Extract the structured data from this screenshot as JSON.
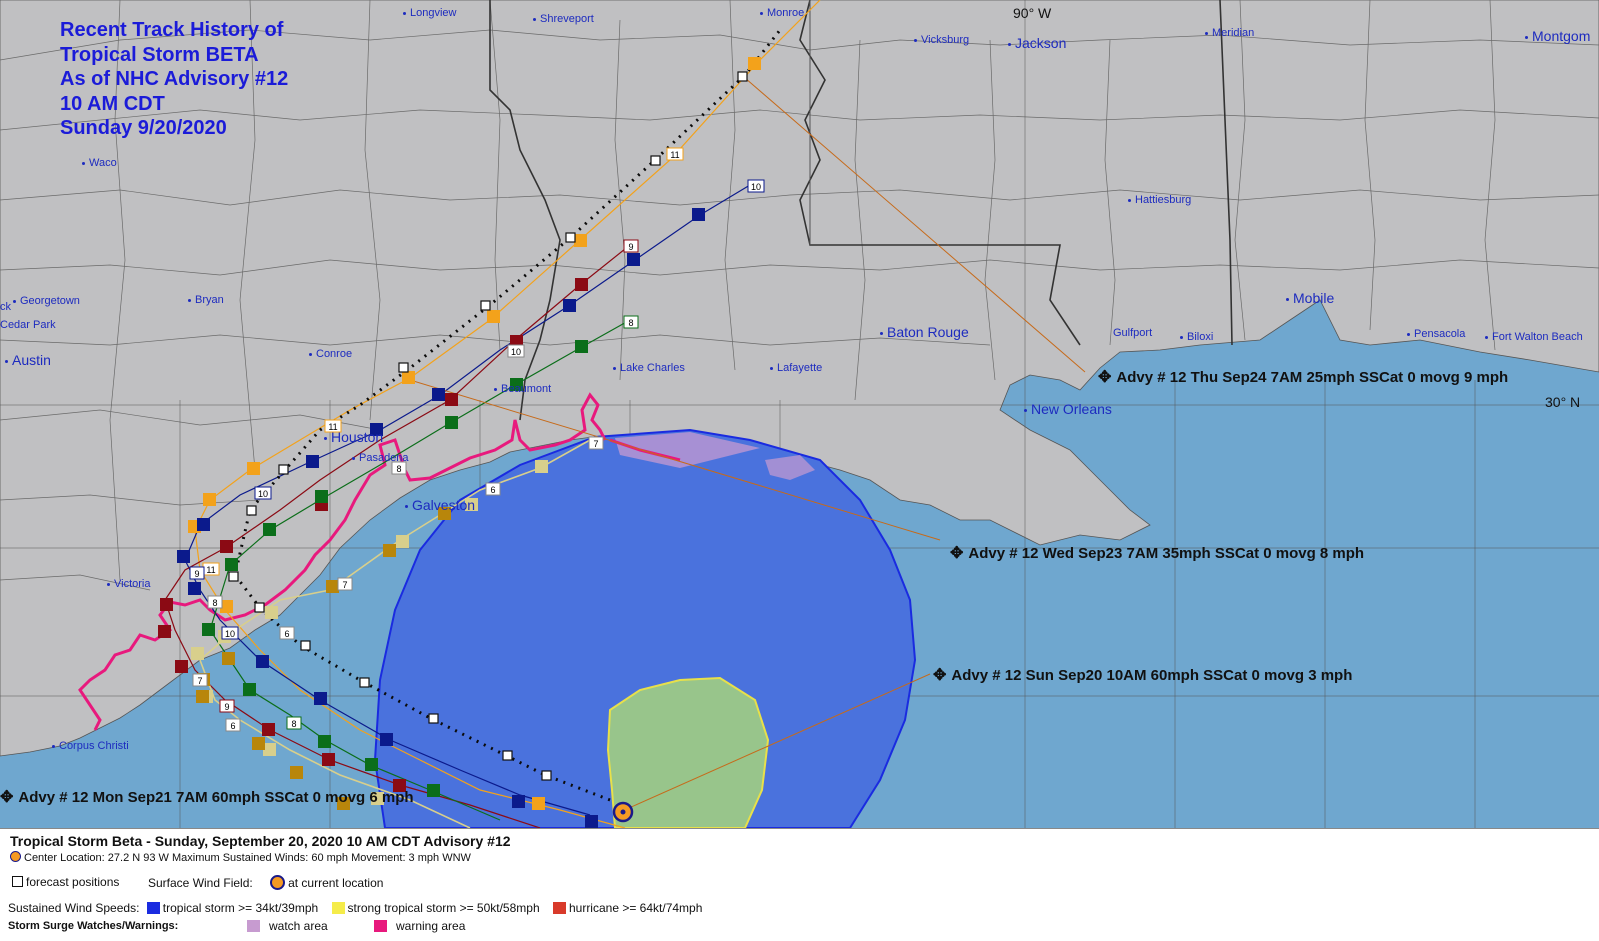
{
  "title_lines": [
    "Recent Track History of",
    "Tropical Storm BETA",
    "As of NHC Advisory #12",
    "10 AM CDT",
    "Sunday 9/20/2020"
  ],
  "cities": {
    "longview": "Longview",
    "shreveport": "Shreveport",
    "monroe": "Monroe",
    "vicksburg": "Vicksburg",
    "jackson": "Jackson",
    "meridian": "Meridian",
    "montgomery": "Montgom",
    "waco": "Waco",
    "hattiesburg": "Hattiesburg",
    "georgetown": "Georgetown",
    "bryan": "Bryan",
    "cedar_park": "Cedar Park",
    "austin": "Austin",
    "conroe": "Conroe",
    "mobile": "Mobile",
    "baton_rouge": "Baton Rouge",
    "gulfport": "Gulfport",
    "biloxi": "Biloxi",
    "pensacola": "Pensacola",
    "fort_walton": "Fort Walton Beach",
    "lake_charles": "Lake Charles",
    "lafayette": "Lafayette",
    "beaumont": "Beaumont",
    "new_orleans": "New Orleans",
    "houston": "Houston",
    "pasadena": "Pasadena",
    "galveston": "Galveston",
    "victoria": "Victoria",
    "corpus_christi": "Corpus Christi",
    "ck": "ck"
  },
  "grid": {
    "lon90": "90° W",
    "lat30": "30° N"
  },
  "advisories": {
    "thu": "Advy # 12 Thu Sep24 7AM  25mph SSCat 0 movg 9 mph",
    "wed": "Advy # 12 Wed Sep23 7AM  35mph SSCat 0 movg 8 mph",
    "sun": "Advy # 12 Sun Sep20 10AM  60mph SSCat 0 movg 3 mph",
    "mon": "Advy # 12 Mon Sep21 7AM  60mph SSCat 0 movg 6 mph"
  },
  "track_labels": {
    "t11": "11",
    "t10": "10",
    "t9": "9",
    "t8": "8",
    "t7": "7",
    "t6": "6",
    "l10a": "10",
    "l11b": "11",
    "l9b": "9",
    "l8b": "8",
    "l10b": "10",
    "l7c": "7",
    "l9c": "9",
    "l6c": "6",
    "l8c": "8",
    "l7d": "7",
    "l10c": "10",
    "l11c": "11",
    "l6d": "6",
    "l8d": "8"
  },
  "legend": {
    "header": "Tropical Storm Beta  -  Sunday, September 20, 2020  10 AM CDT   Advisory #12",
    "center_line": "Center Location: 27.2 N  93 W   Maximum Sustained Winds: 60 mph  Movement: 3 mph WNW",
    "forecast_positions": "forecast positions",
    "surface_wind_field": "Surface Wind Field:",
    "at_current_location": "at current location",
    "sustained_label": "Sustained Wind Speeds:",
    "ts": "tropical storm >= 34kt/39mph",
    "sts": "strong tropical storm >= 50kt/58mph",
    "hu": "hurricane >= 64kt/74mph",
    "surge_label": "Storm Surge Watches/Warnings:",
    "watch": "watch area",
    "warning": "warning area"
  },
  "colors": {
    "land": "#c0c0c2",
    "ocean": "#6fa7cf",
    "ts_field": "#4a72dd",
    "hu_field": "#98c58b",
    "hu_outline": "#e8e04a",
    "ts_outline": "#1a2be0",
    "warning": "#e8197d",
    "watch": "#c79bd0",
    "track_navy": "#0b1a8c",
    "track_red": "#8b0a14",
    "track_green": "#0b6e1a",
    "track_orange": "#f3a21b",
    "track_gold": "#b8860b",
    "track_tan": "#d8cf8c",
    "title": "#1b1bd8"
  }
}
